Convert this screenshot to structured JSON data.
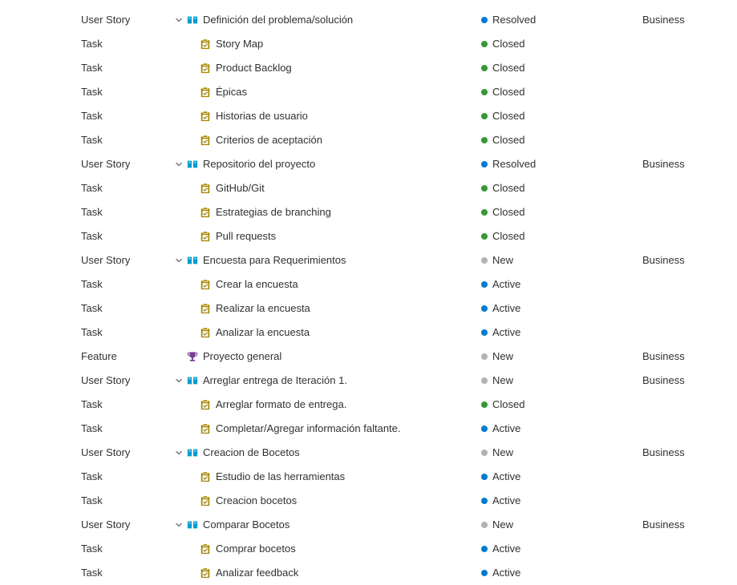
{
  "colors": {
    "resolved": "#0078d4",
    "closed": "#339933",
    "new": "#b2b2b2",
    "active": "#007acc",
    "story_icon": "#009ccc",
    "task_icon": "#a4880a",
    "feature_icon": "#773b93"
  },
  "rows": [
    {
      "type": "User Story",
      "kind": "story",
      "title": "Definición del problema/solución",
      "state": "Resolved",
      "state_key": "resolved",
      "area": "Business"
    },
    {
      "type": "Task",
      "kind": "task",
      "title": "Story Map",
      "state": "Closed",
      "state_key": "closed",
      "area": ""
    },
    {
      "type": "Task",
      "kind": "task",
      "title": "Product Backlog",
      "state": "Closed",
      "state_key": "closed",
      "area": ""
    },
    {
      "type": "Task",
      "kind": "task",
      "title": "Épicas",
      "state": "Closed",
      "state_key": "closed",
      "area": ""
    },
    {
      "type": "Task",
      "kind": "task",
      "title": "Historias de usuario",
      "state": "Closed",
      "state_key": "closed",
      "area": ""
    },
    {
      "type": "Task",
      "kind": "task",
      "title": "Criterios de aceptación",
      "state": "Closed",
      "state_key": "closed",
      "area": ""
    },
    {
      "type": "User Story",
      "kind": "story",
      "title": "Repositorio del proyecto",
      "state": "Resolved",
      "state_key": "resolved",
      "area": "Business"
    },
    {
      "type": "Task",
      "kind": "task",
      "title": "GitHub/Git",
      "state": "Closed",
      "state_key": "closed",
      "area": ""
    },
    {
      "type": "Task",
      "kind": "task",
      "title": "Estrategias de branching",
      "state": "Closed",
      "state_key": "closed",
      "area": ""
    },
    {
      "type": "Task",
      "kind": "task",
      "title": "Pull requests",
      "state": "Closed",
      "state_key": "closed",
      "area": ""
    },
    {
      "type": "User Story",
      "kind": "story",
      "title": "Encuesta para Requerimientos",
      "state": "New",
      "state_key": "new",
      "area": "Business"
    },
    {
      "type": "Task",
      "kind": "task",
      "title": "Crear la encuesta",
      "state": "Active",
      "state_key": "active",
      "area": ""
    },
    {
      "type": "Task",
      "kind": "task",
      "title": "Realizar la encuesta",
      "state": "Active",
      "state_key": "active",
      "area": ""
    },
    {
      "type": "Task",
      "kind": "task",
      "title": "Analizar la encuesta",
      "state": "Active",
      "state_key": "active",
      "area": ""
    },
    {
      "type": "Feature",
      "kind": "feature",
      "title": "Proyecto general",
      "state": "New",
      "state_key": "new",
      "area": "Business"
    },
    {
      "type": "User Story",
      "kind": "story",
      "title": "Arreglar entrega de Iteración 1.",
      "state": "New",
      "state_key": "new",
      "area": "Business"
    },
    {
      "type": "Task",
      "kind": "task",
      "title": "Arreglar formato de entrega.",
      "state": "Closed",
      "state_key": "closed",
      "area": ""
    },
    {
      "type": "Task",
      "kind": "task",
      "title": "Completar/Agregar información faltante.",
      "state": "Active",
      "state_key": "active",
      "area": ""
    },
    {
      "type": "User Story",
      "kind": "story",
      "title": "Creacion de Bocetos",
      "state": "New",
      "state_key": "new",
      "area": "Business"
    },
    {
      "type": "Task",
      "kind": "task",
      "title": "Estudio de las herramientas",
      "state": "Active",
      "state_key": "active",
      "area": ""
    },
    {
      "type": "Task",
      "kind": "task",
      "title": "Creacion bocetos",
      "state": "Active",
      "state_key": "active",
      "area": ""
    },
    {
      "type": "User Story",
      "kind": "story",
      "title": "Comparar Bocetos",
      "state": "New",
      "state_key": "new",
      "area": "Business"
    },
    {
      "type": "Task",
      "kind": "task",
      "title": "Comprar bocetos",
      "state": "Active",
      "state_key": "active",
      "area": ""
    },
    {
      "type": "Task",
      "kind": "task",
      "title": "Analizar feedback",
      "state": "Active",
      "state_key": "active",
      "area": ""
    }
  ]
}
